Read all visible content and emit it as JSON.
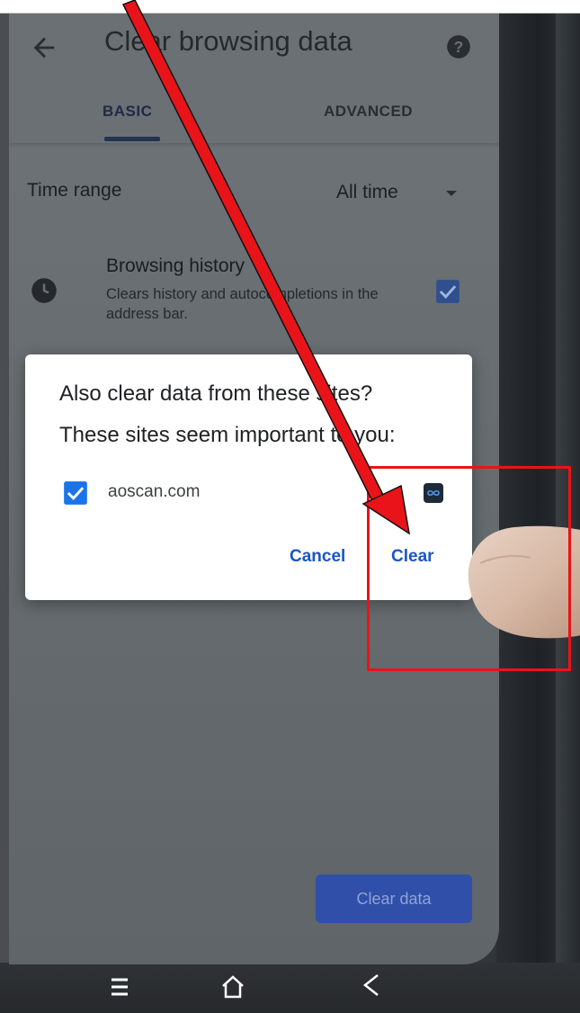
{
  "header": {
    "title": "Clear browsing data",
    "tabs": [
      {
        "label": "BASIC",
        "selected": true
      },
      {
        "label": "ADVANCED",
        "selected": false
      }
    ]
  },
  "settings": {
    "time_range_label": "Time range",
    "time_range_value": "All time"
  },
  "items": [
    {
      "title": "Browsing history",
      "description": "Clears history and autocompletions in the address bar.",
      "checked": true,
      "icon": "clock-icon"
    }
  ],
  "dialog": {
    "title": "Also clear data from these sites?",
    "subtitle": "These sites seem important to you:",
    "sites": [
      {
        "name": "aoscan.com",
        "checked": true,
        "icon": "site-favicon-icon"
      }
    ],
    "cancel_label": "Cancel",
    "clear_label": "Clear"
  },
  "footer": {
    "clear_data_label": "Clear data"
  },
  "annotations": {
    "highlight_color": "#e8141a",
    "arrow_color": "#e8141a"
  },
  "colors": {
    "accent": "#1a56c8",
    "checkbox": "#1a73e8"
  }
}
